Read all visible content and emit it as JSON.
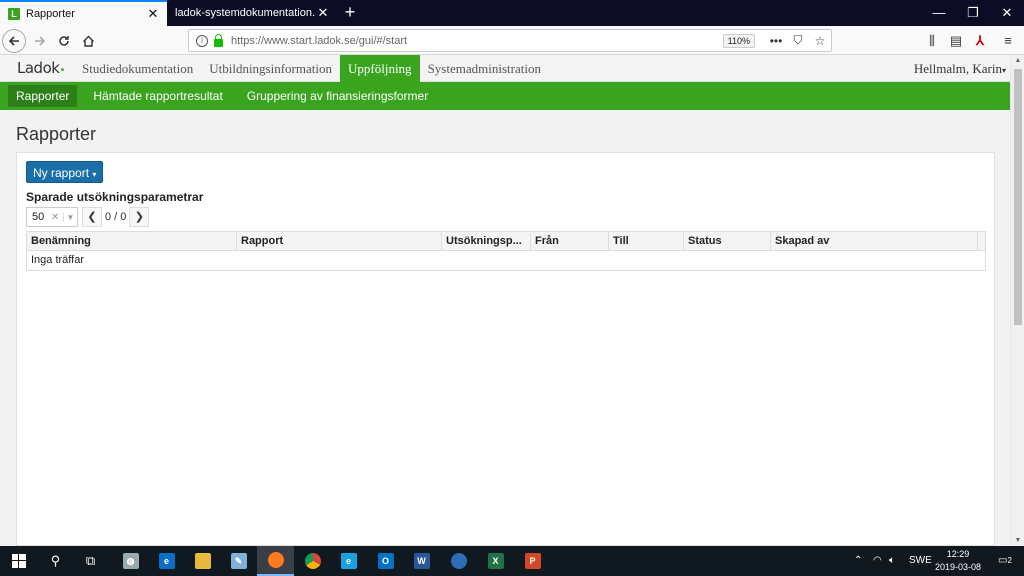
{
  "browser": {
    "tabs": [
      {
        "title": "Rapporter",
        "favicon": "L"
      },
      {
        "title": "ladok-systemdokumentation.pdf"
      }
    ],
    "url": "https://www.start.ladok.se/gui/#/start",
    "zoom": "110%",
    "win_minimize": "—",
    "win_restore": "❐",
    "win_close": "✕"
  },
  "app": {
    "logo": "Ladok",
    "main_nav": [
      {
        "label": "Studiedokumentation"
      },
      {
        "label": "Utbildningsinformation"
      },
      {
        "label": "Uppföljning"
      },
      {
        "label": "Systemadministration"
      }
    ],
    "user": "Hellmalm, Karin",
    "sub_nav": [
      {
        "label": "Rapporter"
      },
      {
        "label": "Hämtade rapportresultat"
      },
      {
        "label": "Gruppering av finansieringsformer"
      }
    ],
    "accent_color": "#3aa41f"
  },
  "page": {
    "title": "Rapporter",
    "new_report_button": "Ny rapport",
    "saved_section_title": "Sparade utsökningsparametrar",
    "page_size": "50",
    "pager_count": "0 / 0",
    "columns": [
      "Benämning",
      "Rapport",
      "Utsökningsp...",
      "Från",
      "Till",
      "Status",
      "Skapad av"
    ],
    "empty_text": "Inga träffar"
  },
  "taskbar": {
    "language": "SWE",
    "time": "12:29",
    "date": "2019-03-08",
    "notifications": "2"
  }
}
